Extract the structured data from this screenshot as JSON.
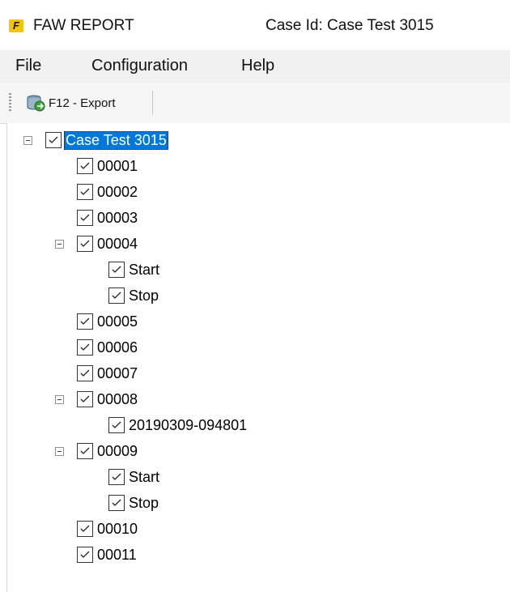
{
  "window": {
    "app_icon_letter": "F",
    "title": "FAW REPORT",
    "case_label": "Case Id: Case Test 3015"
  },
  "menu": {
    "items": [
      "File",
      "Configuration",
      "Help"
    ]
  },
  "toolbar": {
    "export_label": "F12 - Export"
  },
  "tree": {
    "root": "Case Test 3015",
    "nodes": [
      "00001",
      "00002",
      "00003",
      "00004",
      "Start",
      "Stop",
      "00005",
      "00006",
      "00007",
      "00008",
      "20190309-094801",
      "00009",
      "Start",
      "Stop",
      "00010",
      "00011"
    ]
  },
  "colors": {
    "selection": "#0078d7",
    "menubar": "#f0f0f0"
  }
}
